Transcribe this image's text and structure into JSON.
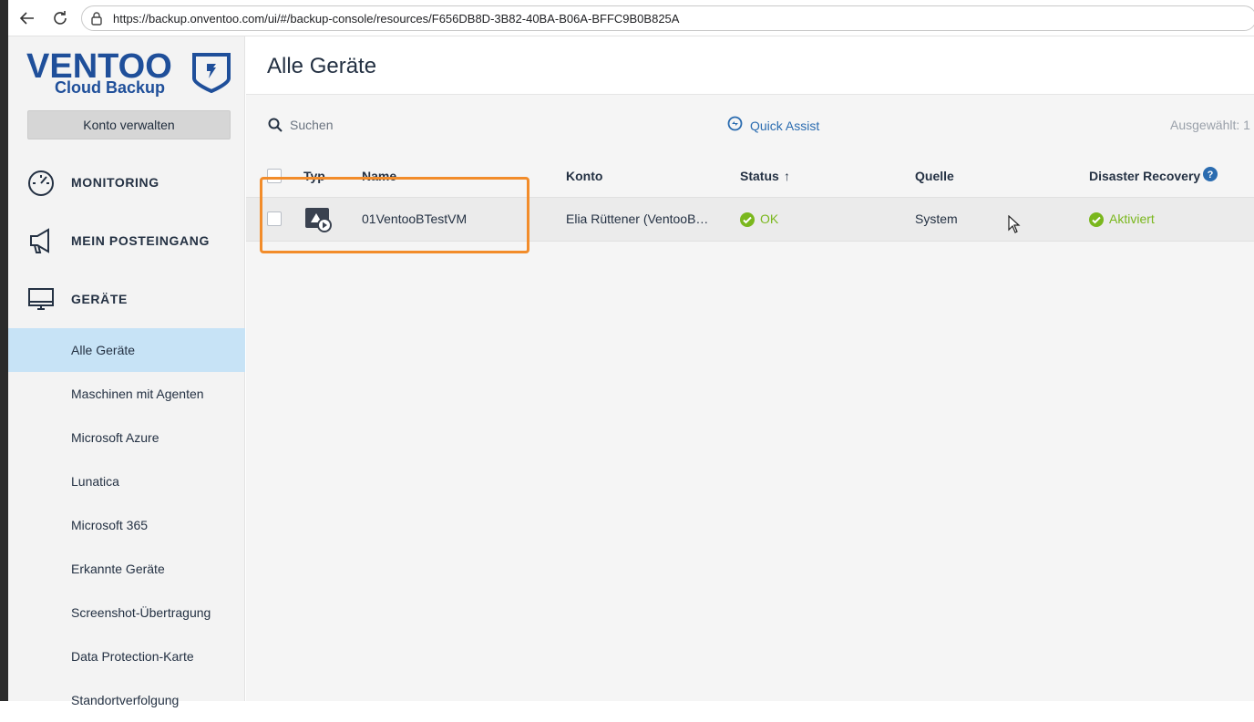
{
  "browser": {
    "url": "https://backup.onventoo.com/ui/#/backup-console/resources/F656DB8D-3B82-40BA-B06A-BFFC9B0B825A"
  },
  "brand": {
    "logo_main": "VENTOO",
    "logo_sub": "Cloud Backup",
    "color": "#1f4f9a"
  },
  "sidebar": {
    "konto_button": "Konto verwalten",
    "sections": [
      {
        "label": "MONITORING",
        "icon": "gauge-icon"
      },
      {
        "label": "MEIN POSTEINGANG",
        "icon": "megaphone-icon"
      },
      {
        "label": "GERÄTE",
        "icon": "monitor-icon"
      }
    ],
    "items": [
      {
        "label": "Alle Geräte",
        "active": true
      },
      {
        "label": "Maschinen mit Agenten"
      },
      {
        "label": "Microsoft Azure"
      },
      {
        "label": "Lunatica"
      },
      {
        "label": "Microsoft 365"
      },
      {
        "label": "Erkannte Geräte"
      },
      {
        "label": "Screenshot-Übertragung"
      },
      {
        "label": "Data Protection-Karte"
      },
      {
        "label": "Standortverfolgung"
      }
    ]
  },
  "main": {
    "title": "Alle Geräte",
    "search_label": "Suchen",
    "quick_assist": "Quick Assist",
    "selected": "Ausgewählt: 1"
  },
  "table": {
    "columns": {
      "typ": "Typ",
      "name": "Name",
      "konto": "Konto",
      "status": "Status",
      "status_sort": "↑",
      "quelle": "Quelle",
      "dr": "Disaster Recovery"
    },
    "rows": [
      {
        "name": "01VentooBTestVM",
        "konto": "Elia Rüttener (VentooB…",
        "status": "OK",
        "quelle": "System",
        "dr": "Aktiviert"
      }
    ]
  },
  "colors": {
    "accent": "#2b6cb0",
    "ok": "#7ab71d",
    "highlight": "#f28c2a",
    "active_bg": "#c7e3f6"
  }
}
